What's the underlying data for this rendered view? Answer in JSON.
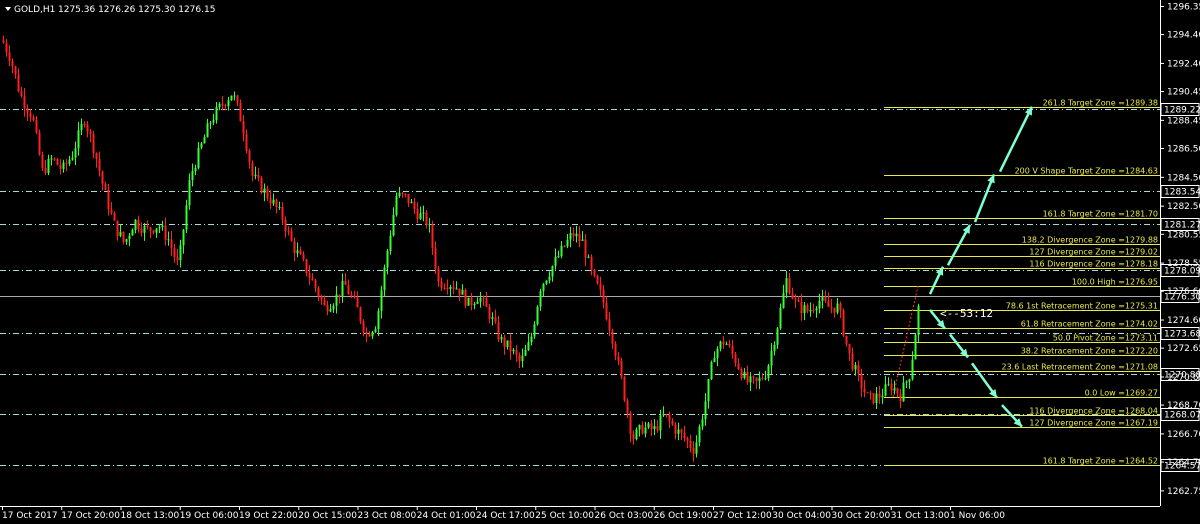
{
  "header": {
    "symbol": "GOLD,H1",
    "ohlc": "1275.36 1276.26 1275.30 1276.15"
  },
  "timer_label": "<--53:12",
  "colors": {
    "background": "#000000",
    "bull": "#33ff33",
    "bear": "#ff2020",
    "fib": "#e8e84a",
    "support": "#9fdfdf",
    "arrow": "#7fffd4",
    "bid": "#aaaaaa"
  },
  "chart_data": {
    "type": "candlestick",
    "ylim": [
      1261.7,
      1296.8
    ],
    "y_ticks": [
      "1296.35",
      "1294.40",
      "1292.40",
      "1290.45",
      "1288.45",
      "1286.50",
      "1284.50",
      "1282.50",
      "1280.55",
      "1278.55",
      "1276.60",
      "1274.60",
      "1272.65",
      "1270.65",
      "1268.70",
      "1266.70",
      "1264.75",
      "1262.75"
    ],
    "x_ticks": [
      "17 Oct 2017",
      "17 Oct 20:00",
      "18 Oct 13:00",
      "19 Oct 06:00",
      "19 Oct 22:00",
      "20 Oct 15:00",
      "23 Oct 08:00",
      "24 Oct 01:00",
      "24 Oct 17:00",
      "25 Oct 10:00",
      "26 Oct 03:00",
      "26 Oct 19:00",
      "27 Oct 12:00",
      "30 Oct 04:00",
      "30 Oct 20:00",
      "31 Oct 13:00",
      "1 Nov 06:00"
    ],
    "support_levels": [
      {
        "label": "1289.22",
        "value": 1289.22
      },
      {
        "label": "1283.54",
        "value": 1283.54
      },
      {
        "label": "1281.27",
        "value": 1281.27
      },
      {
        "label": "1278.09",
        "value": 1278.09
      },
      {
        "label": "1273.68",
        "value": 1273.68
      },
      {
        "label": "1270.88",
        "value": 1270.88
      },
      {
        "label": "1268.07",
        "value": 1268.07
      },
      {
        "label": "1264.57",
        "value": 1264.57
      }
    ],
    "current_price": {
      "label": "1276.30",
      "value": 1276.3
    },
    "fib_levels": [
      {
        "label": "261.8 Target Zone =1289.38",
        "value": 1289.38
      },
      {
        "label": "200 V Shape Target Zone =1284.63",
        "value": 1284.63
      },
      {
        "label": "161.8 Target Zone =1281.70",
        "value": 1281.7
      },
      {
        "label": "138.2 Divergence Zone =1279.88",
        "value": 1279.88
      },
      {
        "label": "127 Divergence Zone =1279.02",
        "value": 1279.02
      },
      {
        "label": "116 Divergence Zone =1278.18",
        "value": 1278.18
      },
      {
        "label": "100.0 High =1276.95",
        "value": 1276.95
      },
      {
        "label": "78.6 1st Retracement Zone =1275.31",
        "value": 1275.31
      },
      {
        "label": "61.8 Retracement Zone =1274.02",
        "value": 1274.02
      },
      {
        "label": "50.0 Pivot Zone =1273.11",
        "value": 1273.11
      },
      {
        "label": "38.2 Retracement Zone =1272.20",
        "value": 1272.2
      },
      {
        "label": "23.6 Last Retracement Zone =1271.08",
        "value": 1271.08
      },
      {
        "label": "0.0 Low =1269.27",
        "value": 1269.27
      },
      {
        "label": "116 Divergence Zone =1268.04",
        "value": 1268.04
      },
      {
        "label": "127 Divergence Zone =1267.19",
        "value": 1267.19
      },
      {
        "label": "161.8 Target Zone =1264.52",
        "value": 1264.52
      }
    ],
    "projection_up": [
      [
        1276.4,
        1278.3
      ],
      [
        1278.4,
        1281.2
      ],
      [
        1281.4,
        1284.7
      ],
      [
        1284.9,
        1289.4
      ]
    ],
    "projection_down": [
      [
        1275.3,
        1274.0
      ],
      [
        1273.6,
        1272.0
      ],
      [
        1271.6,
        1269.2
      ],
      [
        1268.7,
        1267.2
      ]
    ],
    "price_path": [
      [
        0,
        1294.3
      ],
      [
        10,
        1292.8
      ],
      [
        20,
        1290.2
      ],
      [
        32,
        1288.7
      ],
      [
        42,
        1284.9
      ],
      [
        52,
        1285.8
      ],
      [
        62,
        1285.0
      ],
      [
        72,
        1286.1
      ],
      [
        84,
        1288.6
      ],
      [
        94,
        1286.4
      ],
      [
        104,
        1283.5
      ],
      [
        114,
        1281.2
      ],
      [
        124,
        1279.9
      ],
      [
        134,
        1281.5
      ],
      [
        146,
        1280.8
      ],
      [
        158,
        1281.2
      ],
      [
        168,
        1280.2
      ],
      [
        178,
        1278.3
      ],
      [
        190,
        1284.6
      ],
      [
        200,
        1286.5
      ],
      [
        210,
        1288.4
      ],
      [
        220,
        1289.4
      ],
      [
        232,
        1290.4
      ],
      [
        242,
        1288.2
      ],
      [
        252,
        1284.6
      ],
      [
        262,
        1283.7
      ],
      [
        272,
        1282.8
      ],
      [
        282,
        1281.7
      ],
      [
        292,
        1279.8
      ],
      [
        302,
        1278.6
      ],
      [
        314,
        1277.0
      ],
      [
        324,
        1275.5
      ],
      [
        334,
        1276.0
      ],
      [
        344,
        1277.1
      ],
      [
        356,
        1275.5
      ],
      [
        366,
        1273.6
      ],
      [
        376,
        1274.4
      ],
      [
        386,
        1279.0
      ],
      [
        396,
        1283.2
      ],
      [
        406,
        1283.1
      ],
      [
        416,
        1282.1
      ],
      [
        428,
        1281.3
      ],
      [
        438,
        1277.2
      ],
      [
        448,
        1277.2
      ],
      [
        458,
        1276.8
      ],
      [
        468,
        1275.7
      ],
      [
        478,
        1276.3
      ],
      [
        490,
        1274.9
      ],
      [
        500,
        1273.2
      ],
      [
        510,
        1272.6
      ],
      [
        520,
        1271.6
      ],
      [
        530,
        1273.1
      ],
      [
        540,
        1276.9
      ],
      [
        550,
        1278.1
      ],
      [
        562,
        1279.5
      ],
      [
        572,
        1280.6
      ],
      [
        582,
        1280.0
      ],
      [
        592,
        1277.6
      ],
      [
        602,
        1276.1
      ],
      [
        612,
        1273.4
      ],
      [
        622,
        1270.1
      ],
      [
        632,
        1266.4
      ],
      [
        642,
        1267.1
      ],
      [
        654,
        1267.0
      ],
      [
        664,
        1268.0
      ],
      [
        674,
        1267.1
      ],
      [
        684,
        1266.4
      ],
      [
        694,
        1265.6
      ],
      [
        704,
        1268.6
      ],
      [
        714,
        1272.4
      ],
      [
        724,
        1273.2
      ],
      [
        736,
        1271.7
      ],
      [
        746,
        1270.3
      ],
      [
        756,
        1270.2
      ],
      [
        766,
        1271.0
      ],
      [
        776,
        1273.9
      ],
      [
        786,
        1277.4
      ],
      [
        796,
        1275.6
      ],
      [
        808,
        1275.2
      ],
      [
        818,
        1276.0
      ],
      [
        828,
        1275.5
      ],
      [
        838,
        1275.5
      ],
      [
        848,
        1272.3
      ],
      [
        858,
        1270.5
      ],
      [
        868,
        1269.1
      ],
      [
        878,
        1269.3
      ],
      [
        890,
        1270.1
      ],
      [
        900,
        1269.4
      ],
      [
        910,
        1271.0
      ],
      [
        920,
        1276.5
      ]
    ]
  }
}
